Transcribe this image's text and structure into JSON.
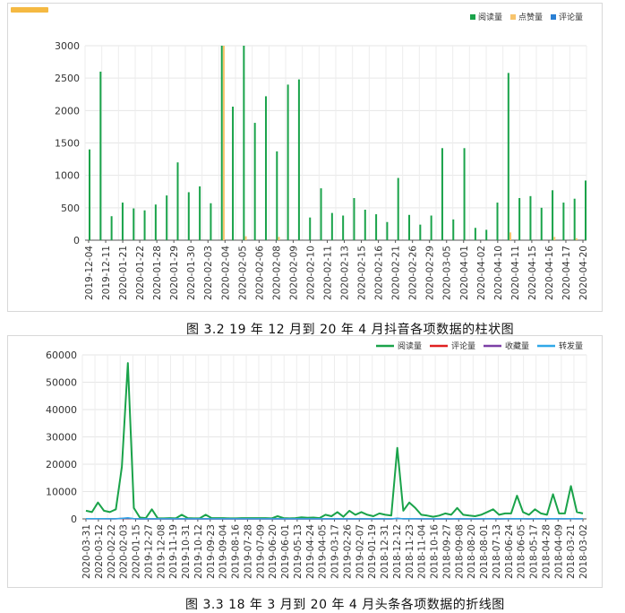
{
  "captions": {
    "fig1": "图 3.2   19 年 12 月到 20 年 4 月抖音各项数据的柱状图",
    "fig2": "图 3.3   18 年 3 月到 20 年 4 月头条各项数据的折线图"
  },
  "colors": {
    "green": "#1aa34a",
    "yellow": "#f7c46c",
    "blue": "#2a7fd4",
    "red": "#e02020",
    "purple": "#7b3fa6",
    "cyan": "#2fa8e8",
    "accent": "#f5b942"
  },
  "chart_data": [
    {
      "type": "bar",
      "ylim": [
        0,
        3000
      ],
      "yticks": [
        0,
        500,
        1000,
        1500,
        2000,
        2500,
        3000
      ],
      "grid": true,
      "legend_position": "top-right",
      "x_tick_labels": [
        "2019-12-04",
        "2019-12-11",
        "2020-01-21",
        "2020-01-22",
        "2020-01-28",
        "2020-01-29",
        "2020-01-30",
        "2020-02-03",
        "2020-02-04",
        "2020-02-05",
        "2020-02-06",
        "2020-02-08",
        "2020-02-09",
        "2020-02-10",
        "2020-02-11",
        "2020-02-13",
        "2020-02-15",
        "2020-02-16",
        "2020-02-21",
        "2020-02-26",
        "2020-02-29",
        "2020-03-05",
        "2020-04-01",
        "2020-04-02",
        "2020-04-10",
        "2020-04-11",
        "2020-04-15",
        "2020-04-16",
        "2020-04-17",
        "2020-04-20"
      ],
      "series": [
        {
          "name": "阅读量",
          "color_key": "green",
          "values": [
            1400,
            2600,
            370,
            580,
            490,
            460,
            550,
            690,
            1200,
            740,
            830,
            570,
            3000,
            2060,
            3000,
            1810,
            2220,
            1370,
            2400,
            2480,
            350,
            800,
            420,
            380,
            650,
            470,
            400,
            280,
            960,
            390,
            240,
            380,
            1420,
            320,
            1420,
            190,
            160,
            580,
            2580,
            650,
            680,
            500,
            770,
            580,
            640,
            920
          ]
        },
        {
          "name": "点赞量",
          "color_key": "yellow",
          "values": [
            0,
            0,
            0,
            0,
            0,
            0,
            0,
            0,
            0,
            0,
            0,
            0,
            3000,
            0,
            60,
            0,
            0,
            50,
            0,
            0,
            0,
            0,
            0,
            0,
            0,
            0,
            0,
            0,
            0,
            0,
            0,
            0,
            0,
            0,
            0,
            0,
            0,
            0,
            120,
            0,
            0,
            0,
            50,
            0,
            30,
            0
          ]
        },
        {
          "name": "评论量",
          "color_key": "blue",
          "values": [
            0,
            0,
            0,
            0,
            0,
            0,
            0,
            0,
            0,
            0,
            0,
            0,
            0,
            0,
            0,
            0,
            0,
            0,
            0,
            0,
            0,
            0,
            0,
            0,
            0,
            0,
            0,
            0,
            0,
            0,
            0,
            0,
            0,
            0,
            0,
            0,
            0,
            0,
            0,
            0,
            0,
            0,
            0,
            0,
            0,
            0
          ]
        }
      ]
    },
    {
      "type": "line",
      "ylim": [
        0,
        60000
      ],
      "yticks": [
        0,
        10000,
        20000,
        30000,
        40000,
        50000,
        60000
      ],
      "grid": true,
      "legend_position": "top-right",
      "x_tick_labels": [
        "2020-03-31",
        "2020-03-12",
        "2020-02-22",
        "2020-02-03",
        "2020-01-15",
        "2019-12-27",
        "2019-12-08",
        "2019-11-19",
        "2019-10-31",
        "2019-10-12",
        "2019-09-23",
        "2019-09-04",
        "2019-08-16",
        "2019-07-28",
        "2019-07-09",
        "2019-06-20",
        "2019-06-01",
        "2019-05-13",
        "2019-04-24",
        "2019-04-05",
        "2019-03-17",
        "2019-02-26",
        "2019-02-07",
        "2019-01-19",
        "2018-12-31",
        "2018-12-12",
        "2018-11-23",
        "2018-11-04",
        "2018-10-16",
        "2018-09-27",
        "2018-09-08",
        "2018-08-20",
        "2018-08-01",
        "2018-07-13",
        "2018-06-24",
        "2018-06-05",
        "2018-05-17",
        "2018-04-28",
        "2018-04-09",
        "2018-03-21",
        "2018-03-02"
      ],
      "series": [
        {
          "name": "阅读量",
          "color_key": "green",
          "values": [
            3000,
            2500,
            6000,
            3000,
            2500,
            3500,
            19000,
            57000,
            4000,
            500,
            300,
            3500,
            200,
            200,
            300,
            200,
            1500,
            300,
            200,
            200,
            1500,
            300,
            300,
            300,
            200,
            200,
            300,
            300,
            300,
            300,
            300,
            200,
            1000,
            300,
            200,
            300,
            600,
            400,
            500,
            300,
            1500,
            1000,
            2500,
            800,
            3000,
            1500,
            2500,
            1500,
            1000,
            2000,
            1500,
            1200,
            26000,
            3000,
            6000,
            4000,
            1500,
            1200,
            800,
            1200,
            2000,
            1500,
            4000,
            1500,
            1200,
            1000,
            1500,
            2500,
            3500,
            1500,
            2000,
            2000,
            8500,
            2500,
            1500,
            3500,
            2000,
            1500,
            9000,
            2000,
            2000,
            12000,
            2500,
            2000
          ]
        },
        {
          "name": "评论量",
          "color_key": "red",
          "values": [
            50,
            40,
            60,
            40,
            30,
            40,
            150,
            300,
            40,
            10,
            10,
            30,
            10,
            10,
            10,
            10,
            20,
            10,
            10,
            10,
            20,
            10,
            10,
            10,
            10,
            10,
            10,
            10,
            10,
            10,
            10,
            10,
            20,
            10,
            10,
            10,
            10,
            10,
            10,
            10,
            20,
            10,
            20,
            10,
            20,
            10,
            20,
            10,
            10,
            20,
            10,
            10,
            150,
            20,
            40,
            30,
            10,
            10,
            10,
            10,
            20,
            10,
            30,
            10,
            10,
            10,
            10,
            20,
            30,
            10,
            20,
            20,
            60,
            20,
            10,
            30,
            20,
            10,
            60,
            20,
            20,
            80,
            20,
            20
          ]
        },
        {
          "name": "收藏量",
          "color_key": "purple",
          "values": [
            40,
            30,
            50,
            30,
            30,
            30,
            120,
            250,
            30,
            10,
            10,
            20,
            10,
            10,
            10,
            10,
            20,
            10,
            10,
            10,
            20,
            10,
            10,
            10,
            10,
            10,
            10,
            10,
            10,
            10,
            10,
            10,
            20,
            10,
            10,
            10,
            10,
            10,
            10,
            10,
            20,
            10,
            20,
            10,
            20,
            10,
            20,
            10,
            10,
            20,
            10,
            10,
            120,
            20,
            30,
            20,
            10,
            10,
            10,
            10,
            20,
            10,
            20,
            10,
            10,
            10,
            10,
            20,
            20,
            10,
            20,
            20,
            50,
            20,
            10,
            20,
            20,
            10,
            50,
            20,
            20,
            60,
            20,
            20
          ]
        },
        {
          "name": "转发量",
          "color_key": "cyan",
          "values": [
            60,
            50,
            80,
            50,
            40,
            50,
            200,
            400,
            50,
            20,
            20,
            40,
            20,
            20,
            20,
            20,
            30,
            20,
            20,
            20,
            30,
            20,
            20,
            20,
            20,
            20,
            20,
            20,
            20,
            20,
            20,
            20,
            30,
            20,
            20,
            20,
            20,
            20,
            20,
            20,
            30,
            20,
            30,
            20,
            30,
            20,
            30,
            20,
            20,
            30,
            20,
            20,
            200,
            30,
            50,
            40,
            20,
            20,
            20,
            20,
            30,
            20,
            40,
            20,
            20,
            20,
            20,
            30,
            40,
            20,
            30,
            30,
            80,
            30,
            20,
            40,
            30,
            20,
            80,
            30,
            30,
            100,
            30,
            30
          ]
        }
      ]
    }
  ]
}
